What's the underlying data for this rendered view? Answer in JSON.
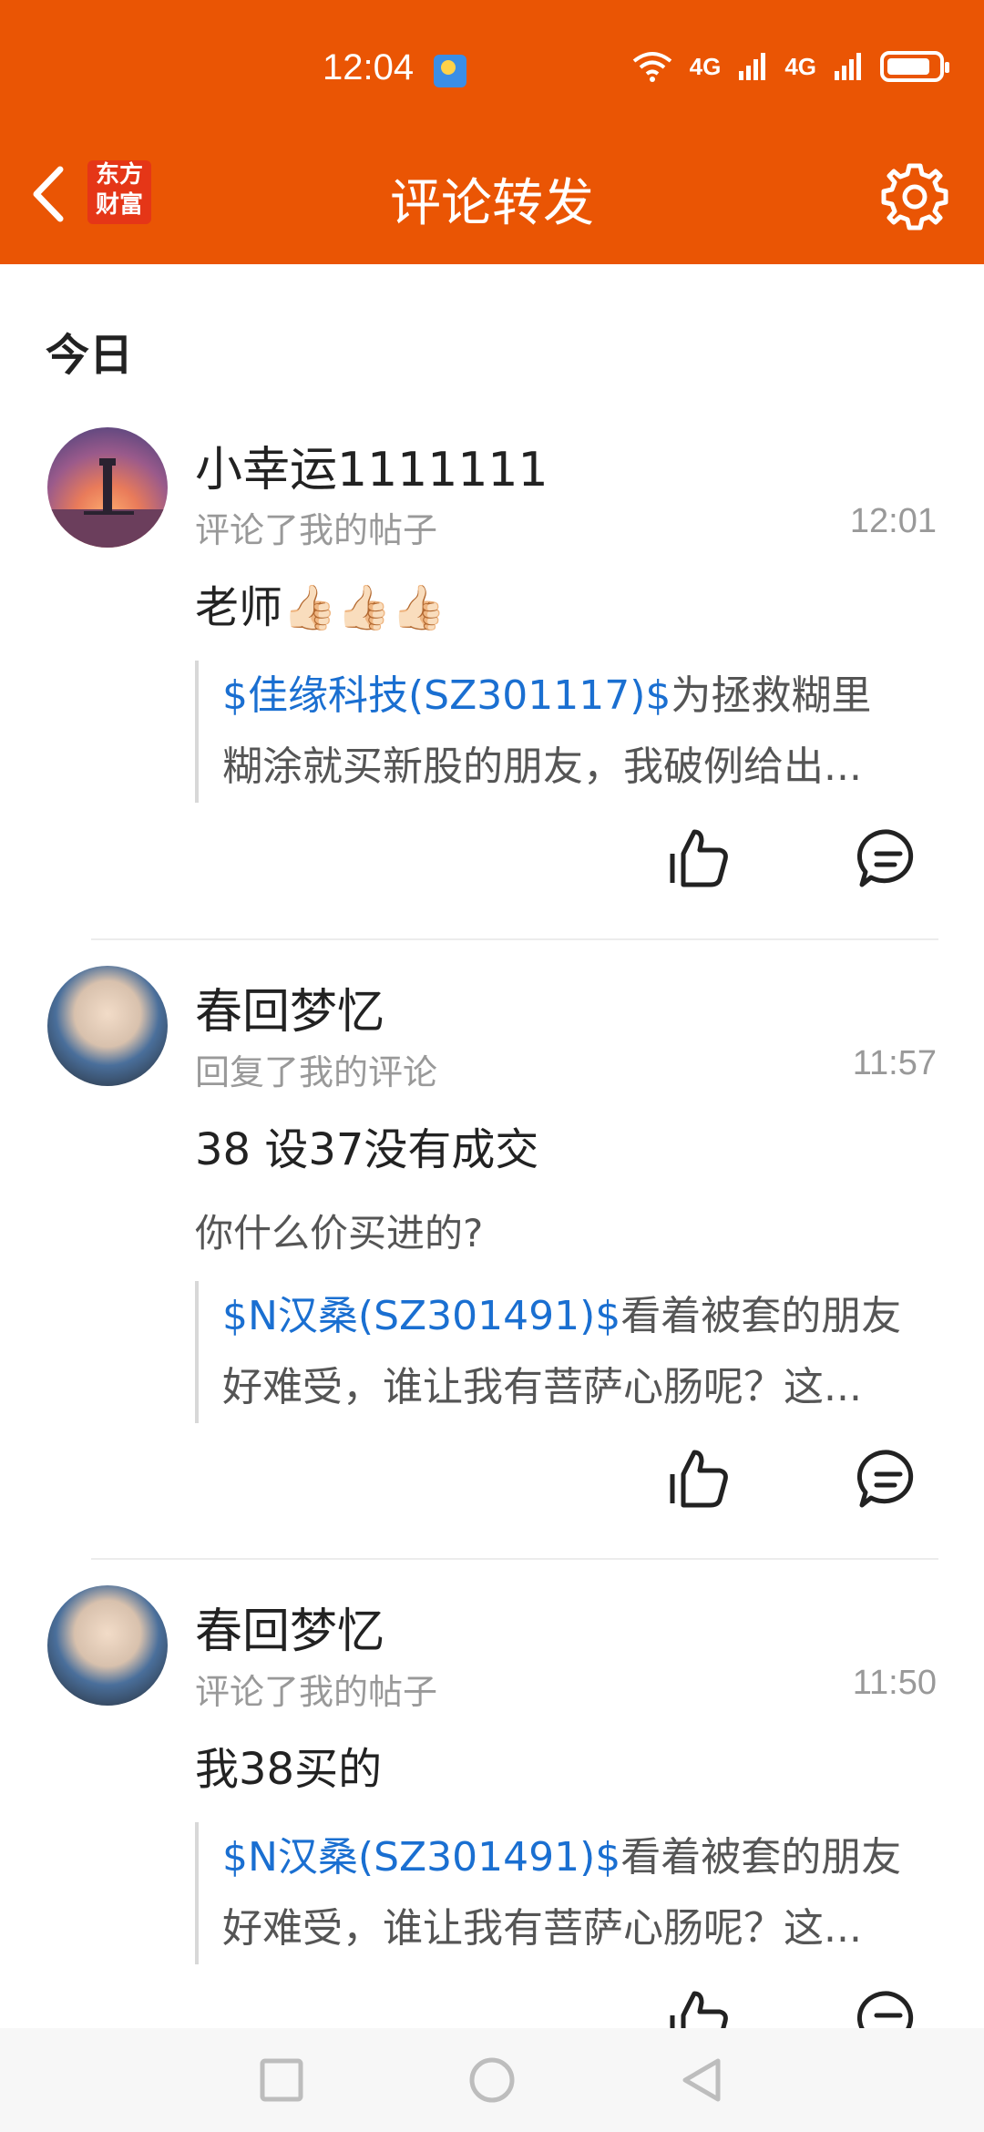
{
  "status_bar": {
    "time": "12:04",
    "signal1": "4G",
    "signal2": "4G",
    "weather_icon": "weather-sun-icon"
  },
  "header": {
    "logo_line1": "东方",
    "logo_line2": "财富",
    "title": "评论转发",
    "accent_color": "#ea5504"
  },
  "section_title": "今日",
  "items": [
    {
      "name": "小幸运1111111",
      "action": "评论了我的帖子",
      "time": "12:01",
      "text": "老师👍🏻👍🏻👍🏻",
      "reply": "",
      "quote_tag": "$佳缘科技(SZ301117)$",
      "quote_line1_rest": "为拯救糊里",
      "quote_line2": "糊涂就买新股的朋友，我破例给出..."
    },
    {
      "name": "春回梦忆",
      "action": "回复了我的评论",
      "time": "11:57",
      "text": "38 设37没有成交",
      "reply": "你什么价买进的?",
      "quote_tag": "$N汉桑(SZ301491)$",
      "quote_line1_rest": "看着被套的朋友",
      "quote_line2": "好难受，谁让我有菩萨心肠呢？这..."
    },
    {
      "name": "春回梦忆",
      "action": "评论了我的帖子",
      "time": "11:50",
      "text": "我38买的",
      "reply": "",
      "quote_tag": "$N汉桑(SZ301491)$",
      "quote_line1_rest": "看着被套的朋友",
      "quote_line2": "好难受，谁让我有菩萨心肠呢？这..."
    }
  ]
}
